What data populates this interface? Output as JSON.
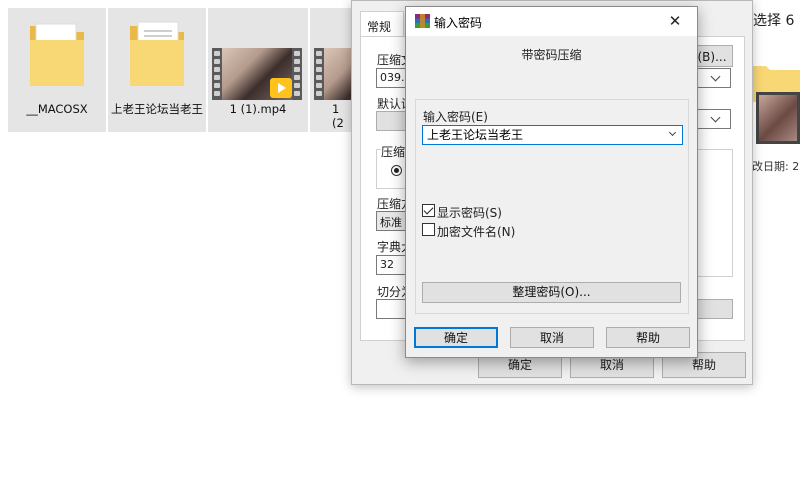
{
  "explorer": {
    "items": [
      {
        "label": "__MACOSX"
      },
      {
        "label": "上老王论坛当老王"
      },
      {
        "label": "1 (1).mp4"
      },
      {
        "label": "1 (2"
      }
    ],
    "header_text": "选择 6",
    "right_date_label": "改日期:  2"
  },
  "archive_dialog": {
    "tab_general": "常规",
    "archive_name_label": "压缩文",
    "archive_name_value": "039.r",
    "browse_button": "(B)...",
    "default_profile_label": "默认设",
    "format_group_label": "压缩",
    "method_label": "压缩方",
    "method_value": "标准",
    "dict_label": "字典大",
    "dict_value": "32",
    "split_label": "切分为",
    "ok_button": "确定",
    "cancel_button": "取消",
    "help_button": "帮助"
  },
  "password_dialog": {
    "title": "输入密码",
    "close_glyph": "✕",
    "subtitle": "带密码压缩",
    "password_label": "输入密码(E)",
    "password_value": "上老王论坛当老王",
    "show_password": {
      "label": "显示密码(S)",
      "checked": true
    },
    "encrypt_names": {
      "label": "加密文件名(N)",
      "checked": false
    },
    "organize_button": "整理密码(O)...",
    "ok_button": "确定",
    "cancel_button": "取消",
    "help_button": "帮助"
  },
  "colors": {
    "accent": "#0078d7",
    "dialog_bg": "#f0f0f0",
    "button_bg": "#e1e1e1",
    "folder_yellow": "#f8d775",
    "selection": "#e5e5e5"
  }
}
